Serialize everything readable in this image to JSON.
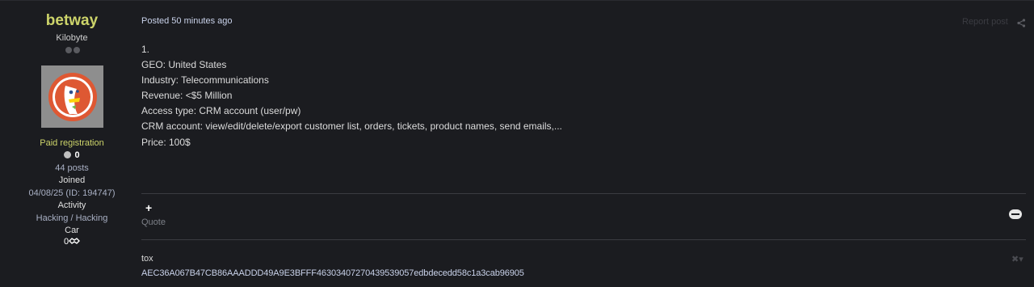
{
  "author": {
    "username": "betway",
    "rank": "Kilobyte",
    "group": "Paid registration",
    "reputation": "0",
    "posts": "44 posts",
    "joined_label": "Joined",
    "joined_value": "04/08/25 (ID: 194747)",
    "activity_label": "Activity",
    "activity_value": "Hacking / Hacking",
    "car_label": "Car",
    "car_value": "0",
    "avatar_icon": "duckduckgo-logo"
  },
  "post": {
    "posted": "Posted 50 minutes ago",
    "report": "Report post",
    "lines": [
      "1.",
      "GEO: United States",
      "Industry: Telecommunications",
      "Revenue: <$5 Million",
      "Access type: CRM account (user/pw)",
      "CRM account: view/edit/delete/export customer list, orders, tickets, product names, send emails,...",
      "Price: 100$"
    ],
    "add_icon": "+",
    "quote_label": "Quote"
  },
  "signature": {
    "label": "tox",
    "value": "AEC36A067B47CB86AAADDD49A9E3BFFF46303407270439539057edbdecedd58c1a3cab96905",
    "close_label": "✖▾"
  }
}
